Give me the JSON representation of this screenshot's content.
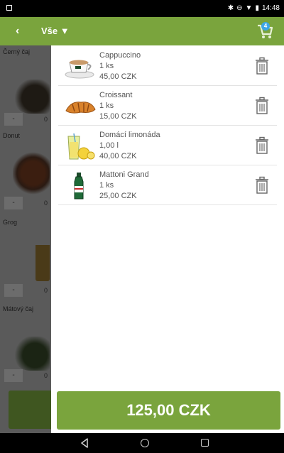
{
  "status_bar": {
    "time": "14:48"
  },
  "header": {
    "back_icon": "chevron-left-icon",
    "filter_label": "Vše ▼",
    "cart_badge": "4"
  },
  "background_products": [
    {
      "name": "Černý čaj",
      "qty": "0"
    },
    {
      "name": "Donut",
      "qty": "0"
    },
    {
      "name": "Grog",
      "qty": "0"
    },
    {
      "name": "Mátový čaj",
      "qty": "0"
    }
  ],
  "cart": {
    "items": [
      {
        "name": "Cappuccino",
        "qty": "1 ks",
        "price": "45,00 CZK",
        "icon": "cappuccino-icon"
      },
      {
        "name": "Croissant",
        "qty": "1 ks",
        "price": "15,00 CZK",
        "icon": "croissant-icon"
      },
      {
        "name": "Domácí limonáda",
        "qty": "1,00 l",
        "price": "40,00 CZK",
        "icon": "lemonade-icon"
      },
      {
        "name": "Mattoni Grand",
        "qty": "1 ks",
        "price": "25,00 CZK",
        "icon": "water-bottle-icon"
      }
    ],
    "total": "125,00 CZK"
  },
  "colors": {
    "accent": "#7aa43d",
    "badge": "#3da6e8"
  }
}
